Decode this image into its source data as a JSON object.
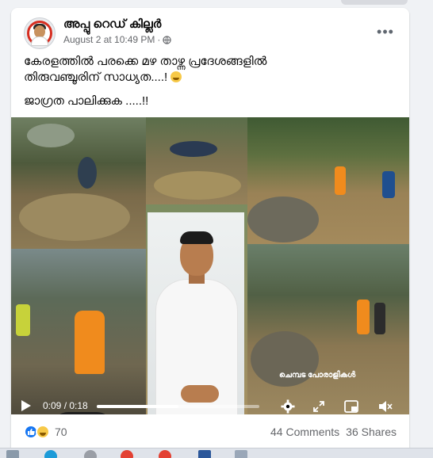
{
  "post": {
    "author": "അപ്പു റെഡ് കില്ലർ",
    "timestamp": "August 2 at 10:49 PM",
    "privacy_sep": "·",
    "more_label": "•••",
    "text_line1": "കേരളത്തിൽ പരക്കെ മഴ താഴ്ന്ന പ്രദേശങ്ങളിൽ",
    "text_line2": "തിരുവഞ്ചൂരിന് സാധ്യത....!",
    "text_line3": "ജാഗ്രത പാലിക്കുക .....!!"
  },
  "video": {
    "current_time": "0:09",
    "time_sep": " / ",
    "duration": "0:18",
    "progress": 0.5,
    "watermark": "ചെമ്പട പോരാളികൾ"
  },
  "footer": {
    "reactions_count": "70",
    "comments": "44 Comments",
    "shares": "36 Shares"
  },
  "icons": {
    "settings": "gear-icon",
    "fullscreen": "expand-icon",
    "pip": "picture-in-picture-icon",
    "volume": "volume-icon",
    "play": "play-icon"
  },
  "colors": {
    "like_blue": "#1877f2",
    "meta_gray": "#65676b",
    "haha_yellow": "#f7c948"
  }
}
